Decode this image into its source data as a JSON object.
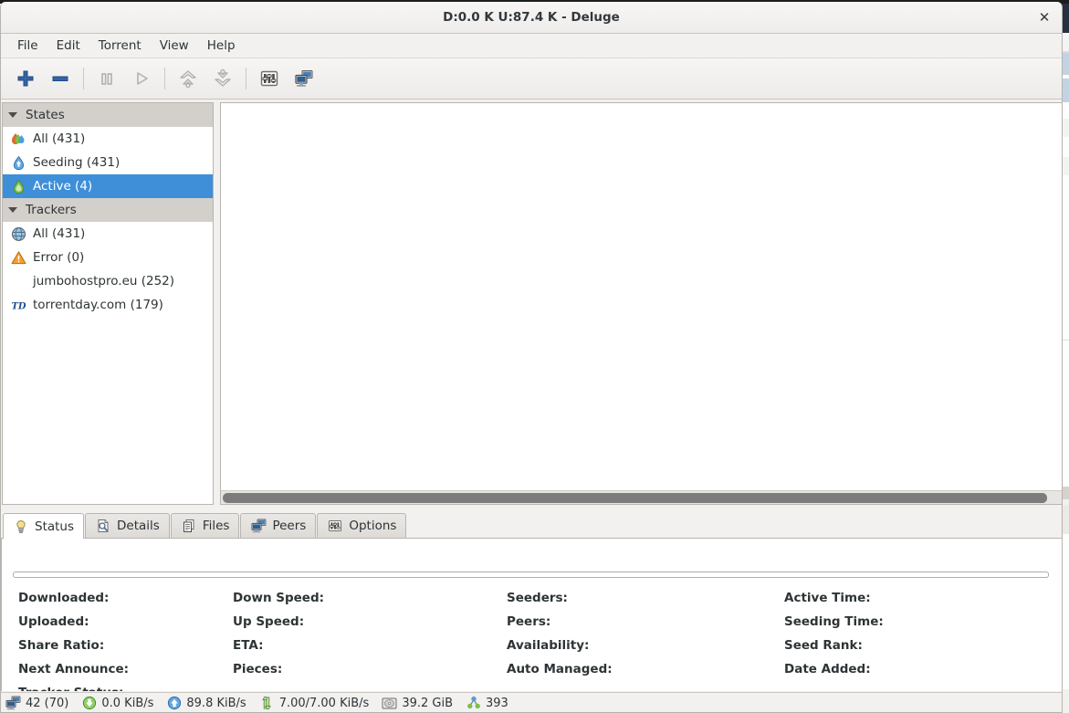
{
  "window": {
    "title": "D:0.0 K U:87.4 K - Deluge",
    "close_label": "✕"
  },
  "menubar": {
    "items": [
      {
        "label": "File"
      },
      {
        "label": "Edit"
      },
      {
        "label": "Torrent"
      },
      {
        "label": "View"
      },
      {
        "label": "Help"
      }
    ]
  },
  "toolbar": {
    "buttons": [
      {
        "name": "add-torrent-button",
        "icon": "plus-icon",
        "enabled": true
      },
      {
        "name": "remove-torrent-button",
        "icon": "minus-icon",
        "enabled": true
      },
      {
        "name": "pause-button",
        "icon": "pause-icon",
        "enabled": false
      },
      {
        "name": "resume-button",
        "icon": "play-icon",
        "enabled": false
      },
      {
        "name": "queue-up-button",
        "icon": "arrow-up-icon",
        "enabled": false
      },
      {
        "name": "queue-down-button",
        "icon": "arrow-down-icon",
        "enabled": false
      },
      {
        "name": "preferences-button",
        "icon": "preferences-icon",
        "enabled": true
      },
      {
        "name": "connection-manager-button",
        "icon": "connection-manager-icon",
        "enabled": true
      }
    ]
  },
  "sidebar": {
    "groups": [
      {
        "label": "States",
        "expanded": true,
        "items": [
          {
            "label": "All (431)",
            "icon": "deluge-all-icon",
            "selected": false
          },
          {
            "label": "Seeding (431)",
            "icon": "seeding-icon",
            "selected": false
          },
          {
            "label": "Active (4)",
            "icon": "active-icon",
            "selected": true
          }
        ]
      },
      {
        "label": "Trackers",
        "expanded": true,
        "items": [
          {
            "label": "All (431)",
            "icon": "globe-icon",
            "selected": false
          },
          {
            "label": "Error (0)",
            "icon": "warning-icon",
            "selected": false
          },
          {
            "label": "jumbohostpro.eu (252)",
            "icon": "blank-icon",
            "selected": false
          },
          {
            "label": "torrentday.com (179)",
            "icon": "td-favicon-icon",
            "selected": false
          }
        ]
      }
    ]
  },
  "tabs": [
    {
      "label": "Status",
      "icon": "lightbulb-icon",
      "active": true
    },
    {
      "label": "Details",
      "icon": "details-icon",
      "active": false
    },
    {
      "label": "Files",
      "icon": "files-icon",
      "active": false
    },
    {
      "label": "Peers",
      "icon": "peers-icon",
      "active": false
    },
    {
      "label": "Options",
      "icon": "options-icon",
      "active": false
    }
  ],
  "status_panel": {
    "progress_percent": 0,
    "columns": [
      {
        "fields": [
          {
            "label": "Downloaded:",
            "value": ""
          },
          {
            "label": "Uploaded:",
            "value": ""
          },
          {
            "label": "Share Ratio:",
            "value": ""
          },
          {
            "label": "Next Announce:",
            "value": ""
          },
          {
            "label": "Tracker Status:",
            "value": ""
          }
        ]
      },
      {
        "fields": [
          {
            "label": "Down Speed:",
            "value": ""
          },
          {
            "label": "Up Speed:",
            "value": ""
          },
          {
            "label": "ETA:",
            "value": ""
          },
          {
            "label": "Pieces:",
            "value": ""
          }
        ]
      },
      {
        "fields": [
          {
            "label": "Seeders:",
            "value": ""
          },
          {
            "label": "Peers:",
            "value": ""
          },
          {
            "label": "Availability:",
            "value": ""
          },
          {
            "label": "Auto Managed:",
            "value": ""
          }
        ]
      },
      {
        "fields": [
          {
            "label": "Active Time:",
            "value": ""
          },
          {
            "label": "Seeding Time:",
            "value": ""
          },
          {
            "label": "Seed Rank:",
            "value": ""
          },
          {
            "label": "Date Added:",
            "value": ""
          }
        ]
      }
    ]
  },
  "statusbar": {
    "items": [
      {
        "name": "connections-status",
        "icon": "computer-icon",
        "label": "42 (70)"
      },
      {
        "name": "download-speed-status",
        "icon": "download-arrow-icon",
        "label": "0.0 KiB/s"
      },
      {
        "name": "upload-speed-status",
        "icon": "upload-arrow-icon",
        "label": "89.8 KiB/s"
      },
      {
        "name": "protocol-traffic-status",
        "icon": "updown-arrow-icon",
        "label": "7.00/7.00 KiB/s"
      },
      {
        "name": "free-space-status",
        "icon": "disk-icon",
        "label": "39.2 GiB"
      },
      {
        "name": "dht-nodes-status",
        "icon": "dht-icon",
        "label": "393"
      }
    ]
  },
  "scrollbar": {
    "horizontal_thumb_percent": 98
  },
  "colors": {
    "selection_blue": "#3e8fd8",
    "toolbar_blue": "#2a5caa",
    "group_header": "#d3d0cb",
    "window_bg": "#f2f1f0",
    "scroll_thumb": "#7c7c7c"
  }
}
